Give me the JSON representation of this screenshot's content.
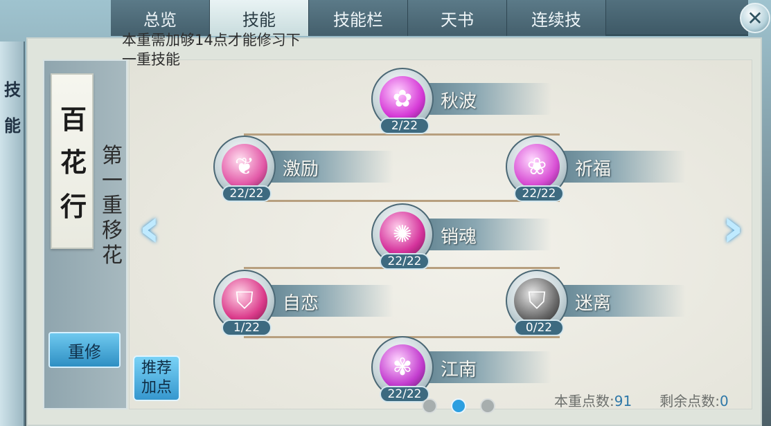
{
  "side_tab": {
    "chars": [
      "技",
      "能"
    ]
  },
  "tabs": [
    {
      "label": "总览",
      "active": false
    },
    {
      "label": "技能",
      "active": true
    },
    {
      "label": "技能栏",
      "active": false
    },
    {
      "label": "天书",
      "active": false
    },
    {
      "label": "连续技",
      "active": false
    }
  ],
  "close_icon": "close-icon",
  "sect": {
    "chars": [
      "百",
      "花",
      "行"
    ]
  },
  "tier_title": [
    "第",
    "一",
    "重",
    "移",
    "花"
  ],
  "hint": "本重需加够14点才能修习下一重技能",
  "reset_label": "重修",
  "recommend_label": "推荐加点",
  "skills": [
    {
      "name": "秋波",
      "count": "2/22",
      "color": "#d63bd7"
    },
    {
      "name": "激励",
      "count": "22/22",
      "color": "#e35aa8"
    },
    {
      "name": "祈福",
      "count": "22/22",
      "color": "#d84fd4"
    },
    {
      "name": "销魂",
      "count": "22/22",
      "color": "#d5339c"
    },
    {
      "name": "自恋",
      "count": "1/22",
      "color": "#db3b8b"
    },
    {
      "name": "迷离",
      "count": "0/22",
      "color": "#6b6b6b"
    },
    {
      "name": "江南",
      "count": "22/22",
      "color": "#c33dcf"
    }
  ],
  "pager": {
    "pages": 3,
    "current": 2
  },
  "points": {
    "tier_label": "本重点数:",
    "tier_value": "91",
    "remain_label": "剩余点数:",
    "remain_value": "0"
  }
}
